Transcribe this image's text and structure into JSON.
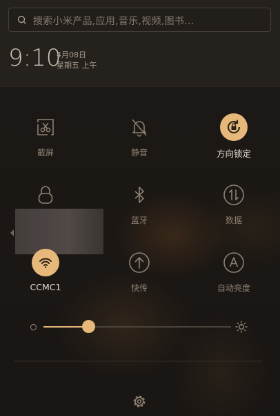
{
  "search": {
    "placeholder": "搜索小米产品,应用,音乐,视频,图书..."
  },
  "status": {
    "time": "9:10",
    "date": "4月08日",
    "weekday": "星期五 上午"
  },
  "toggles": [
    {
      "id": "screenshot",
      "label": "截屏",
      "icon": "screenshot-icon",
      "active": false
    },
    {
      "id": "mute",
      "label": "静音",
      "icon": "bell-off-icon",
      "active": false
    },
    {
      "id": "rotation",
      "label": "方向锁定",
      "icon": "rotation-lock-icon",
      "active": true
    },
    {
      "id": "lock",
      "label": "",
      "icon": "lock-icon",
      "active": false
    },
    {
      "id": "bluetooth",
      "label": "蓝牙",
      "icon": "bluetooth-icon",
      "active": false
    },
    {
      "id": "data",
      "label": "数据",
      "icon": "data-icon",
      "active": false
    },
    {
      "id": "wifi",
      "label": "CCMC1",
      "icon": "wifi-icon",
      "active": true
    },
    {
      "id": "transfer",
      "label": "快传",
      "icon": "upload-icon",
      "active": false
    },
    {
      "id": "autobright",
      "label": "自动亮度",
      "icon": "auto-brightness-icon",
      "active": false
    }
  ],
  "brightness": {
    "level": 0.24
  },
  "colors": {
    "accent": "#e6b87a",
    "background": "#1a1613",
    "icon": "#9b8f80"
  }
}
